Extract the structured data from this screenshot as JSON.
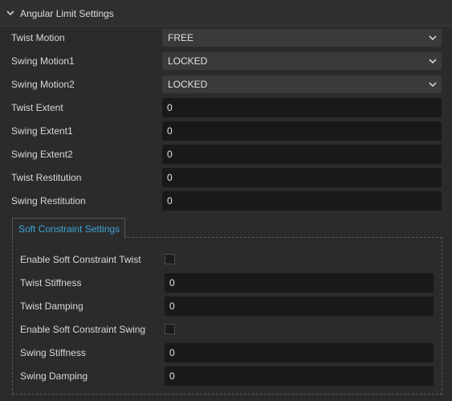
{
  "section": {
    "title": "Angular Limit Settings",
    "icon": "chevron-down-icon"
  },
  "fields": [
    {
      "label": "Twist Motion",
      "value": "FREE",
      "type": "select"
    },
    {
      "label": "Swing Motion1",
      "value": "LOCKED",
      "type": "select"
    },
    {
      "label": "Swing Motion2",
      "value": "LOCKED",
      "type": "select"
    },
    {
      "label": "Twist Extent",
      "value": "0",
      "type": "number"
    },
    {
      "label": "Swing Extent1",
      "value": "0",
      "type": "number"
    },
    {
      "label": "Swing Extent2",
      "value": "0",
      "type": "number"
    },
    {
      "label": "Twist Restitution",
      "value": "0",
      "type": "number"
    },
    {
      "label": "Swing Restitution",
      "value": "0",
      "type": "number"
    }
  ],
  "soft": {
    "tab_label": "Soft Constraint Settings",
    "tab_color": "#3fa5d8",
    "fields": [
      {
        "label": "Enable Soft Constraint Twist",
        "type": "checkbox",
        "checked": false
      },
      {
        "label": "Twist Stiffness",
        "value": "0",
        "type": "number"
      },
      {
        "label": "Twist Damping",
        "value": "0",
        "type": "number"
      },
      {
        "label": "Enable Soft Constraint Swing",
        "type": "checkbox",
        "checked": false
      },
      {
        "label": "Swing Stiffness",
        "value": "0",
        "type": "number"
      },
      {
        "label": "Swing Damping",
        "value": "0",
        "type": "number"
      }
    ]
  }
}
